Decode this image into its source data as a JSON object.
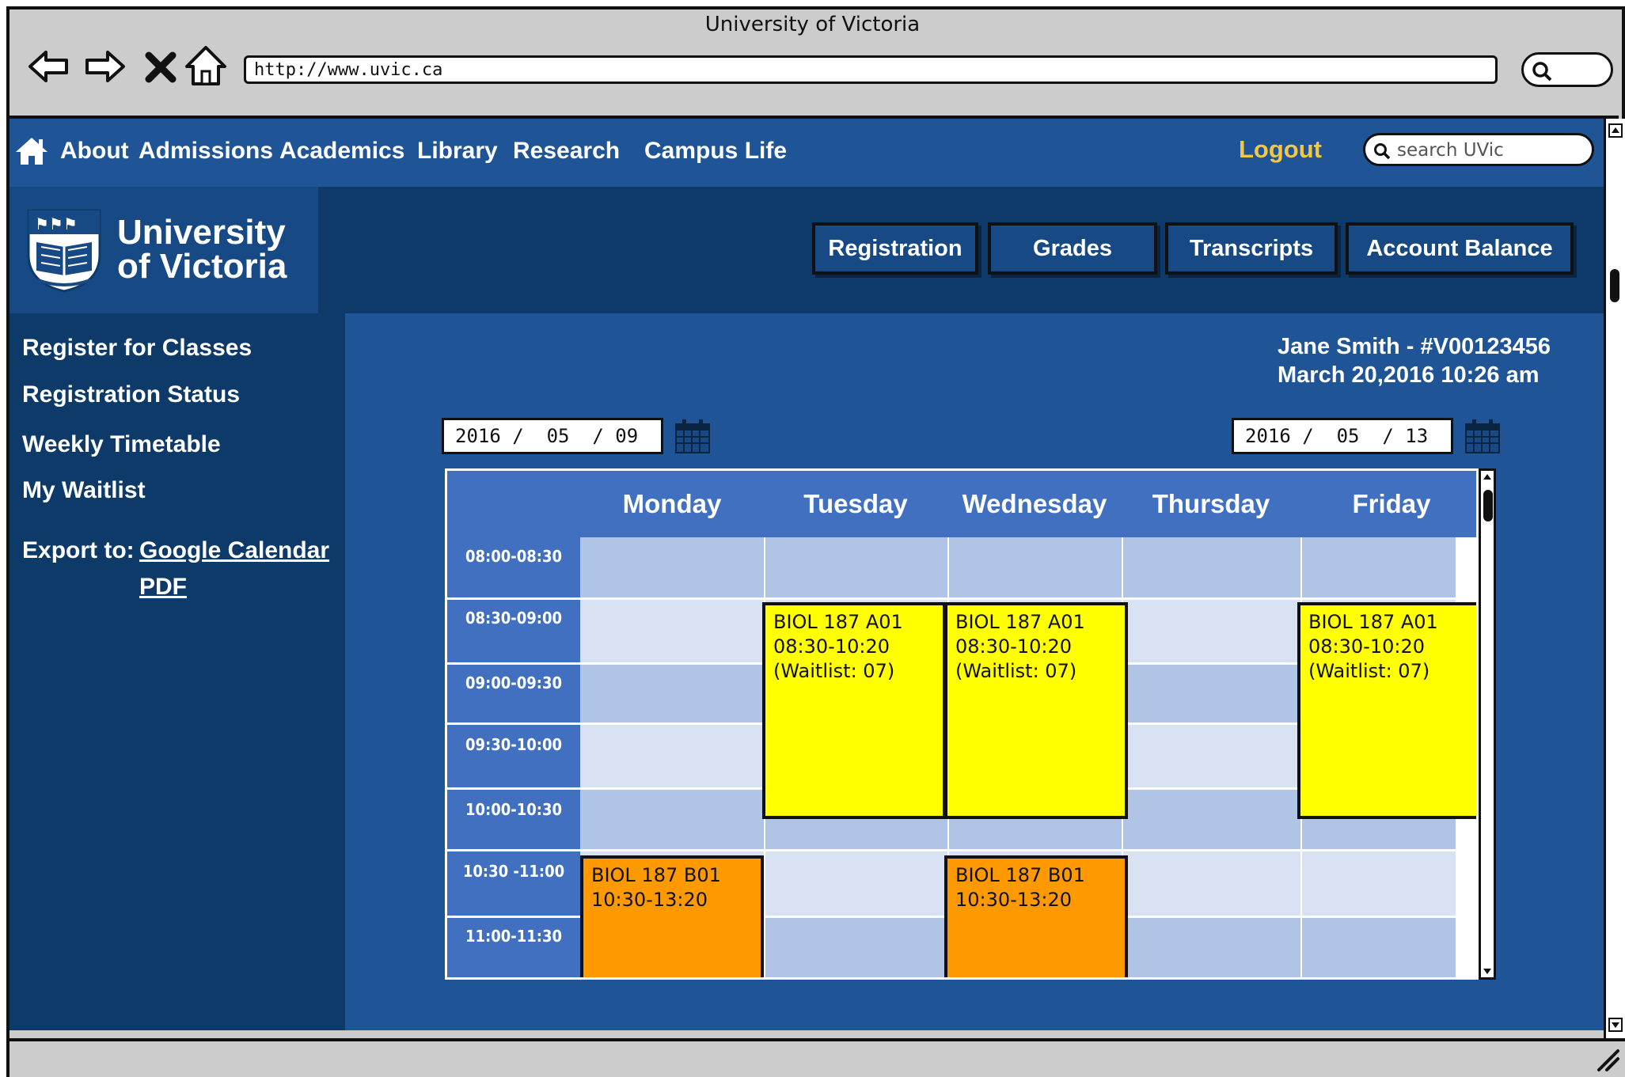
{
  "browser": {
    "title": "University of Victoria",
    "url": "http://www.uvic.ca"
  },
  "topnav": {
    "links": [
      "About",
      "Admissions",
      "Academics",
      "Library",
      "Research",
      "Campus Life"
    ],
    "logout": "Logout",
    "search_placeholder": "search UVic"
  },
  "logo": {
    "line1": "University",
    "line2": "of Victoria"
  },
  "tabs": [
    "Registration",
    "Grades",
    "Transcripts",
    "Account Balance"
  ],
  "sidebar": {
    "links": [
      "Register for Classes",
      "Registration Status",
      "Weekly Timetable",
      "My Waitlist"
    ],
    "export_label": "Export to:",
    "export_links": [
      "Google Calendar",
      "PDF"
    ]
  },
  "user": {
    "name_id": "Jane Smith - #V00123456",
    "datetime": "March 20,2016 10:26 am"
  },
  "date_range": {
    "start": "2016 /  05  / 09",
    "end": "2016 /  05  / 13"
  },
  "timetable": {
    "days": [
      "Monday",
      "Tuesday",
      "Wednesday",
      "Thursday",
      "Friday"
    ],
    "slots": [
      "08:00-08:30",
      "08:30-09:00",
      "09:00-09:30",
      "09:30-10:00",
      "10:00-10:30",
      "10:30 -11:00",
      "11:00-11:30"
    ],
    "events": [
      {
        "day": "Tuesday",
        "text": "BIOL 187 A01\n08:30-10:20\n(Waitlist: 07)",
        "kind": "lecture"
      },
      {
        "day": "Wednesday",
        "text": "BIOL 187 A01\n08:30-10:20\n(Waitlist: 07)",
        "kind": "lecture"
      },
      {
        "day": "Friday",
        "text": "BIOL 187 A01\n08:30-10:20\n(Waitlist: 07)",
        "kind": "lecture"
      },
      {
        "day": "Monday",
        "text": "BIOL 187 B01\n10:30-13:20",
        "kind": "lab"
      },
      {
        "day": "Wednesday",
        "text": "BIOL 187 B01\n10:30-13:20",
        "kind": "lab"
      }
    ]
  },
  "colors": {
    "nav_blue": "#1f5597",
    "dark_blue": "#0d3a69",
    "table_header": "#4170c1",
    "lecture": "#ffff00",
    "lab": "#ff9900",
    "logout": "#f2c744"
  }
}
